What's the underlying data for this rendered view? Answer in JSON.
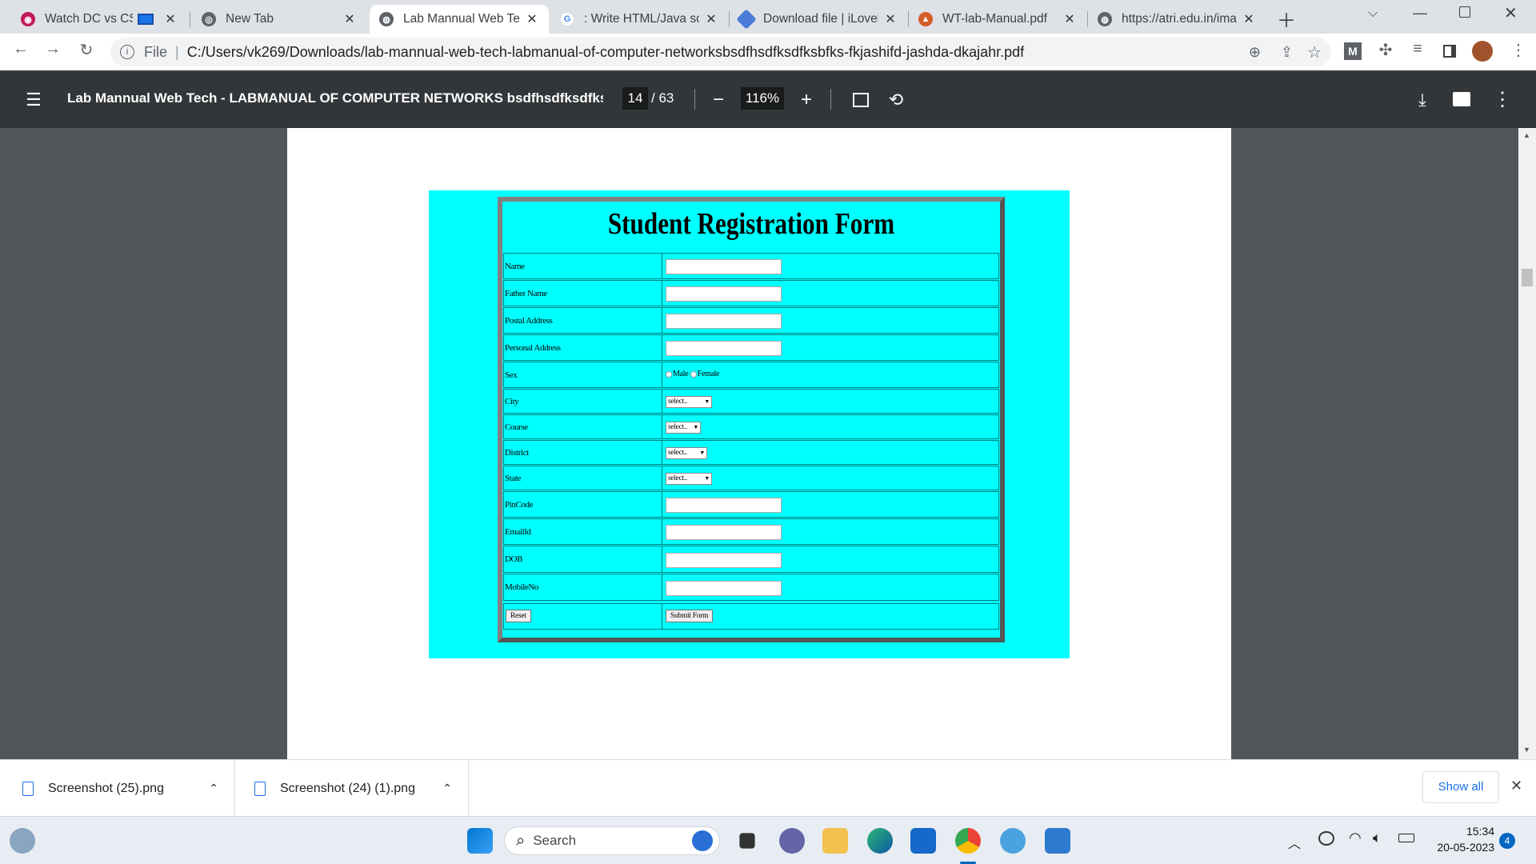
{
  "tabs": [
    {
      "label": "Watch DC vs CSK",
      "icon": "cricket-icon"
    },
    {
      "label": "New Tab",
      "icon": "chrome-icon"
    },
    {
      "label": "Lab Mannual Web Tec",
      "icon": "globe-icon"
    },
    {
      "label": ": Write HTML/Java scr",
      "icon": "google-icon"
    },
    {
      "label": "Download file | iLovel",
      "icon": "ilovepdf-icon"
    },
    {
      "label": "WT-lab-Manual.pdf",
      "icon": "pdf-icon"
    },
    {
      "label": "https://atri.edu.in/ima",
      "icon": "globe-icon"
    }
  ],
  "omnibox": {
    "scheme": "File",
    "url": "C:/Users/vk269/Downloads/lab-mannual-web-tech-labmanual-of-computer-networksbsdfhsdfksdfksbfks-fkjashifd-jashda-dkajahr.pdf"
  },
  "pdf": {
    "title": "Lab Mannual Web Tech - LABMANUAL OF COMPUTER NETWORKS bsdfhsdfksdfksb...",
    "page": "14",
    "total": "/ 63",
    "zoom": "116%"
  },
  "form": {
    "title": "Student Registration Form",
    "rows": [
      {
        "label": "Name",
        "type": "text"
      },
      {
        "label": "Father Name",
        "type": "text"
      },
      {
        "label": "Postal Address",
        "type": "text"
      },
      {
        "label": "Personal Address",
        "type": "text"
      },
      {
        "label": "Sex",
        "type": "radio"
      },
      {
        "label": "City",
        "type": "select"
      },
      {
        "label": "Course",
        "type": "select"
      },
      {
        "label": "District",
        "type": "select"
      },
      {
        "label": "State",
        "type": "select"
      },
      {
        "label": "PinCode",
        "type": "text"
      },
      {
        "label": "EmailId",
        "type": "text"
      },
      {
        "label": "DOB",
        "type": "text"
      },
      {
        "label": "MobileNo",
        "type": "text"
      }
    ],
    "radio_male": "Male",
    "radio_female": "Female",
    "select_placeholder": "select..",
    "reset_label": "Reset",
    "submit_label": "Submit Form"
  },
  "downloads": [
    {
      "name": "Screenshot (25).png"
    },
    {
      "name": "Screenshot (24) (1).png"
    }
  ],
  "show_all": "Show all",
  "taskbar": {
    "search": "Search",
    "time": "15:34",
    "date": "20-05-2023",
    "badge": "4"
  },
  "colors": {
    "form_bg": "#00ffff",
    "pdf_toolbar": "#323639",
    "viewer_bg": "#525659"
  }
}
